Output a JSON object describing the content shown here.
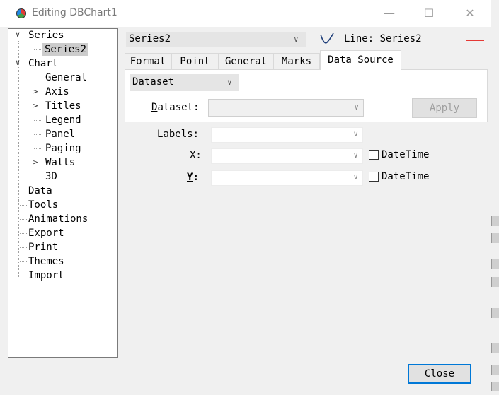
{
  "window": {
    "title": "Editing DBChart1",
    "minimize_glyph": "—",
    "maximize_glyph": "☐",
    "close_glyph": "✕"
  },
  "tree": {
    "series": "Series",
    "series2": "Series2",
    "chart": "Chart",
    "general": "General",
    "axis": "Axis",
    "titles": "Titles",
    "legend": "Legend",
    "panel": "Panel",
    "paging": "Paging",
    "walls": "Walls",
    "three_d": "3D",
    "data": "Data",
    "tools": "Tools",
    "animations": "Animations",
    "export": "Export",
    "print": "Print",
    "themes": "Themes",
    "import": "Import",
    "expanded_glyph": "∨",
    "collapsed_glyph": ">"
  },
  "series_bar": {
    "selected_series": "Series2",
    "series_type_label": "Line: Series2",
    "line_color": "#e53935"
  },
  "tabs": [
    {
      "label": "Format"
    },
    {
      "label": "Point"
    },
    {
      "label": "General"
    },
    {
      "label": "Marks"
    },
    {
      "label": "Data Source"
    }
  ],
  "active_tab": "Data Source",
  "data_source": {
    "source_type": "Dataset",
    "dataset_label_prefix": "",
    "dataset_label_u": "D",
    "dataset_label_rest": "ataset:",
    "dataset_value": "",
    "apply_label": "Apply",
    "labels_label_u": "L",
    "labels_label_rest": "abels:",
    "labels_value": "",
    "x_label": "X:",
    "x_value": "",
    "y_label_u": "Y",
    "y_label_rest": ":",
    "y_value": "",
    "datetime_label": "DateTime",
    "x_datetime_checked": false,
    "y_datetime_checked": false
  },
  "footer": {
    "close_label": "Close"
  },
  "icons": {
    "app": "teechart-app-icon",
    "line": "line-series-icon",
    "dropdown": "chevron-down-icon"
  }
}
